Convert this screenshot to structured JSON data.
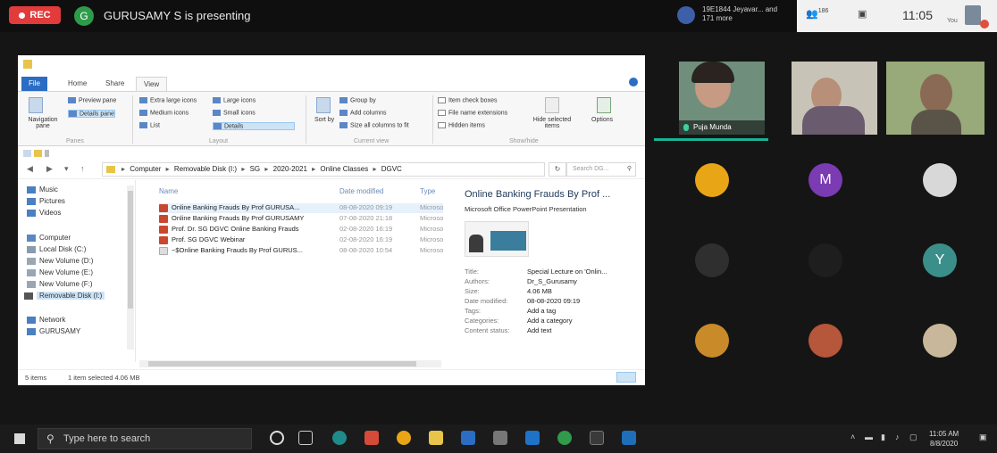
{
  "meeting": {
    "rec_label": "REC",
    "presenter_initial": "G",
    "presenting_text": "GURUSAMY S is presenting",
    "participants_text": "19E1844 Jeyavar... and 171 more",
    "participant_count": "186",
    "clock": "11:05",
    "you_label": "You"
  },
  "explorer": {
    "tabs": [
      "File",
      "Home",
      "Share",
      "View"
    ],
    "ribbon": {
      "navigation_pane": "Navigation pane",
      "preview_pane": "Preview pane",
      "details_pane": "Details pane",
      "panes_group": "Panes",
      "extra_large_icons": "Extra large icons",
      "large_icons": "Large icons",
      "medium_icons": "Medium icons",
      "small_icons": "Small icons",
      "list": "List",
      "details": "Details",
      "layout_group": "Layout",
      "sort_by": "Sort by",
      "group_by": "Group by",
      "add_columns": "Add columns",
      "size_all_columns": "Size all columns to fit",
      "current_view_group": "Current view",
      "item_check_boxes": "Item check boxes",
      "file_name_extensions": "File name extensions",
      "hidden_items": "Hidden items",
      "hide_selected_items": "Hide selected items",
      "show_hide_group": "Show/hide",
      "options": "Options"
    },
    "address": [
      "Computer",
      "Removable Disk (I:)",
      "SG",
      "2020-2021",
      "Online Classes",
      "DGVC"
    ],
    "search_placeholder": "Search DG...",
    "nav_items": [
      {
        "label": "Music",
        "color": "#4a7fc1"
      },
      {
        "label": "Pictures",
        "color": "#4a7fc1"
      },
      {
        "label": "Videos",
        "color": "#4a7fc1"
      },
      {
        "label": "Computer",
        "color": "#5b87c6"
      },
      {
        "label": "Local Disk (C:)",
        "color": "#8a9bb0"
      },
      {
        "label": "New Volume (D:)",
        "color": "#9aa6b4"
      },
      {
        "label": "New Volume (E:)",
        "color": "#9aa6b4"
      },
      {
        "label": "New Volume (F:)",
        "color": "#9aa6b4"
      },
      {
        "label": "Removable Disk (I:)",
        "color": "#555"
      },
      {
        "label": "Network",
        "color": "#4a7fc1"
      },
      {
        "label": "GURUSAMY",
        "color": "#4a7fc1"
      }
    ],
    "columns": {
      "name": "Name",
      "date": "Date modified",
      "type": "Type"
    },
    "files": [
      {
        "name": "Online Banking Frauds By Prof GURUSA...",
        "date": "08-08-2020 09:19",
        "type": "Microso",
        "selected": true,
        "blank": false
      },
      {
        "name": "Online Banking Frauds By Prof GURUSAMY",
        "date": "07-08-2020 21:18",
        "type": "Microso",
        "selected": false,
        "blank": false
      },
      {
        "name": "Prof. Dr. SG DGVC Online Banking Frauds",
        "date": "02-08-2020 16:19",
        "type": "Microso",
        "selected": false,
        "blank": false
      },
      {
        "name": "Prof. SG DGVC Webinar",
        "date": "02-08-2020 16:19",
        "type": "Microso",
        "selected": false,
        "blank": false
      },
      {
        "name": "~$Online Banking Frauds By Prof GURUS...",
        "date": "08-08-2020 10:54",
        "type": "Microso",
        "selected": false,
        "blank": true
      }
    ],
    "details": {
      "title": "Online Banking Frauds By Prof ...",
      "subtitle": "Microsoft Office PowerPoint Presentation",
      "fields": [
        {
          "label": "Title:",
          "value": "Special Lecture on 'Onlin..."
        },
        {
          "label": "Authors:",
          "value": "Dr_S_Gurusamy"
        },
        {
          "label": "Size:",
          "value": "4.06 MB"
        },
        {
          "label": "Date modified:",
          "value": "08-08-2020 09:19"
        },
        {
          "label": "Tags:",
          "value": "Add a tag"
        },
        {
          "label": "Categories:",
          "value": "Add a category"
        },
        {
          "label": "Content status:",
          "value": "Add text"
        }
      ]
    },
    "status": {
      "items": "5 items",
      "selected": "1 item selected 4.06 MB"
    }
  },
  "participants": {
    "active_name": "Puja Munda",
    "avatars": [
      {
        "initial": "",
        "color": "#e8a516"
      },
      {
        "initial": "M",
        "color": "#7a3bb3"
      },
      {
        "initial": "",
        "color": "#d8d8d8"
      },
      {
        "initial": "",
        "color": "#2f2f2f"
      },
      {
        "initial": "",
        "color": "#1e1e1e"
      },
      {
        "initial": "Y",
        "color": "#3b8f8a"
      },
      {
        "initial": "",
        "color": "#c98a2a"
      },
      {
        "initial": "",
        "color": "#b6563a"
      },
      {
        "initial": "",
        "color": "#c9b79b"
      }
    ]
  },
  "taskbar": {
    "search_placeholder": "Type here to search",
    "time": "11:05 AM",
    "date": "8/8/2020"
  }
}
